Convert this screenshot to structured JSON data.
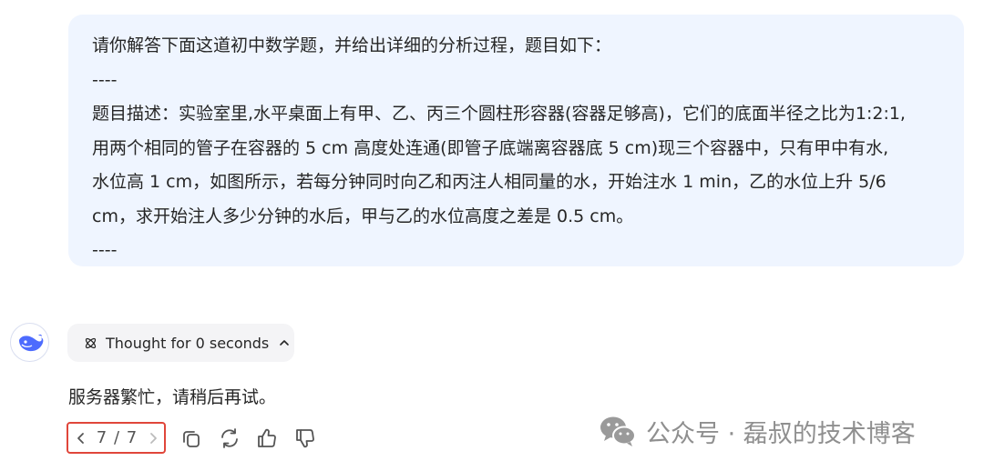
{
  "user_message": {
    "lines": [
      "请你解答下面这道初中数学题，并给出详细的分析过程，题目如下：",
      "----",
      "题目描述：实验室里,水平桌面上有甲、乙、丙三个圆柱形容器(容器足够高)，它们的底面半径之比为1:2:1,",
      "用两个相同的管子在容器的 5 cm 高度处连通(即管子底端离容器底 5 cm)现三个容器中，只有甲中有水,",
      "水位高 1 cm，如图所示，若每分钟同时向乙和丙注人相同量的水，开始注水 1 min，乙的水位上升 5/6",
      "cm，求开始注人多少分钟的水后，甲与乙的水位高度之差是 0.5 cm。",
      "----"
    ]
  },
  "assistant": {
    "avatar_icon": "deepseek-whale-icon",
    "thought_label": "Thought for 0 seconds",
    "reply": "服务器繁忙，请稍后再试。",
    "pager": {
      "count": "7 / 7"
    }
  },
  "actions": [
    "copy-icon",
    "regenerate-icon",
    "thumbs-up-icon",
    "thumbs-down-icon"
  ],
  "watermark": "公众号 · 磊叔的技术博客",
  "colors": {
    "bubble": "#eff5ff",
    "accent": "#4d6bfe",
    "pager_border": "#e0463a"
  }
}
